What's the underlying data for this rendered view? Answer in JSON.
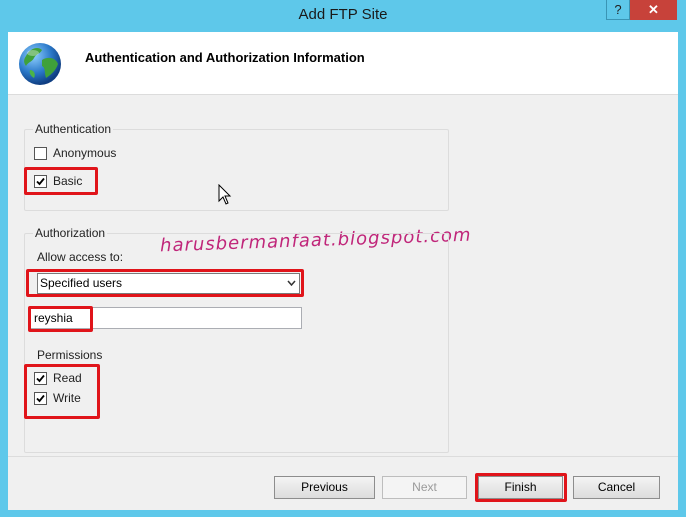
{
  "window": {
    "title": "Add FTP Site",
    "help_label": "?",
    "close_label": "✕"
  },
  "header": {
    "title": "Authentication and Authorization Information",
    "icon": "globe-icon"
  },
  "authentication": {
    "group_title": "Authentication",
    "anonymous": {
      "label": "Anonymous",
      "checked": false
    },
    "basic": {
      "label": "Basic",
      "checked": true
    }
  },
  "authorization": {
    "group_title": "Authorization",
    "allow_access_label": "Allow access to:",
    "allow_access_value": "Specified users",
    "users_value": "reyshia",
    "permissions_title": "Permissions",
    "read": {
      "label": "Read",
      "checked": true
    },
    "write": {
      "label": "Write",
      "checked": true
    }
  },
  "watermark": "harusbermanfaat.blogspot.com",
  "buttons": {
    "previous": "Previous",
    "next": "Next",
    "finish": "Finish",
    "cancel": "Cancel"
  },
  "colors": {
    "window_chrome": "#5ec8ea",
    "highlight": "#e0141a",
    "close_button": "#c7423a",
    "watermark": "#c0267a"
  }
}
